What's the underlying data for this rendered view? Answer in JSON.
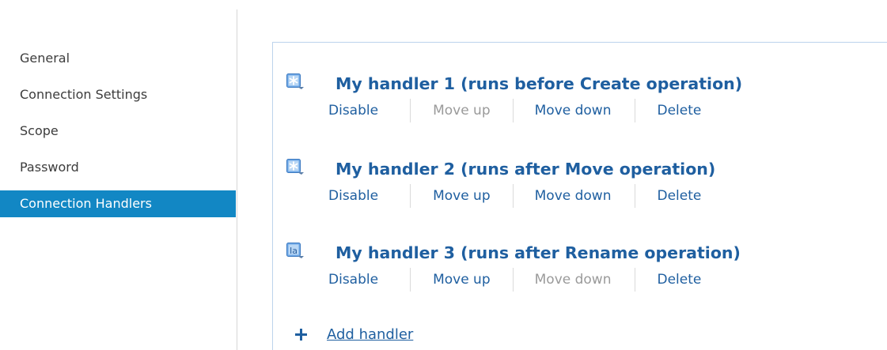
{
  "sidebar": {
    "items": [
      {
        "label": "General",
        "active": false
      },
      {
        "label": "Connection Settings",
        "active": false
      },
      {
        "label": "Scope",
        "active": false
      },
      {
        "label": "Password",
        "active": false
      },
      {
        "label": "Connection Handlers",
        "active": true
      }
    ]
  },
  "handlers": [
    {
      "title": "My handler 1 (runs before Create operation)",
      "icon": "asterisk-script-icon",
      "actions": {
        "disable": {
          "label": "Disable",
          "enabled": true
        },
        "move_up": {
          "label": "Move up",
          "enabled": false
        },
        "move_down": {
          "label": "Move down",
          "enabled": true
        },
        "delete": {
          "label": "Delete",
          "enabled": true
        }
      }
    },
    {
      "title": "My handler 2 (runs after Move operation)",
      "icon": "asterisk-script-icon",
      "actions": {
        "disable": {
          "label": "Disable",
          "enabled": true
        },
        "move_up": {
          "label": "Move up",
          "enabled": true
        },
        "move_down": {
          "label": "Move down",
          "enabled": true
        },
        "delete": {
          "label": "Delete",
          "enabled": true
        }
      }
    },
    {
      "title": "My handler 3 (runs after Rename operation)",
      "icon": "text-script-icon",
      "actions": {
        "disable": {
          "label": "Disable",
          "enabled": true
        },
        "move_up": {
          "label": "Move up",
          "enabled": true
        },
        "move_down": {
          "label": "Move down",
          "enabled": false
        },
        "delete": {
          "label": "Delete",
          "enabled": true
        }
      }
    }
  ],
  "add_handler": {
    "label": "Add handler"
  },
  "colors": {
    "accent": "#1287c4",
    "link": "#1f5fa0",
    "disabled": "#9a9a9a",
    "panel_border": "#bcd3ec"
  }
}
